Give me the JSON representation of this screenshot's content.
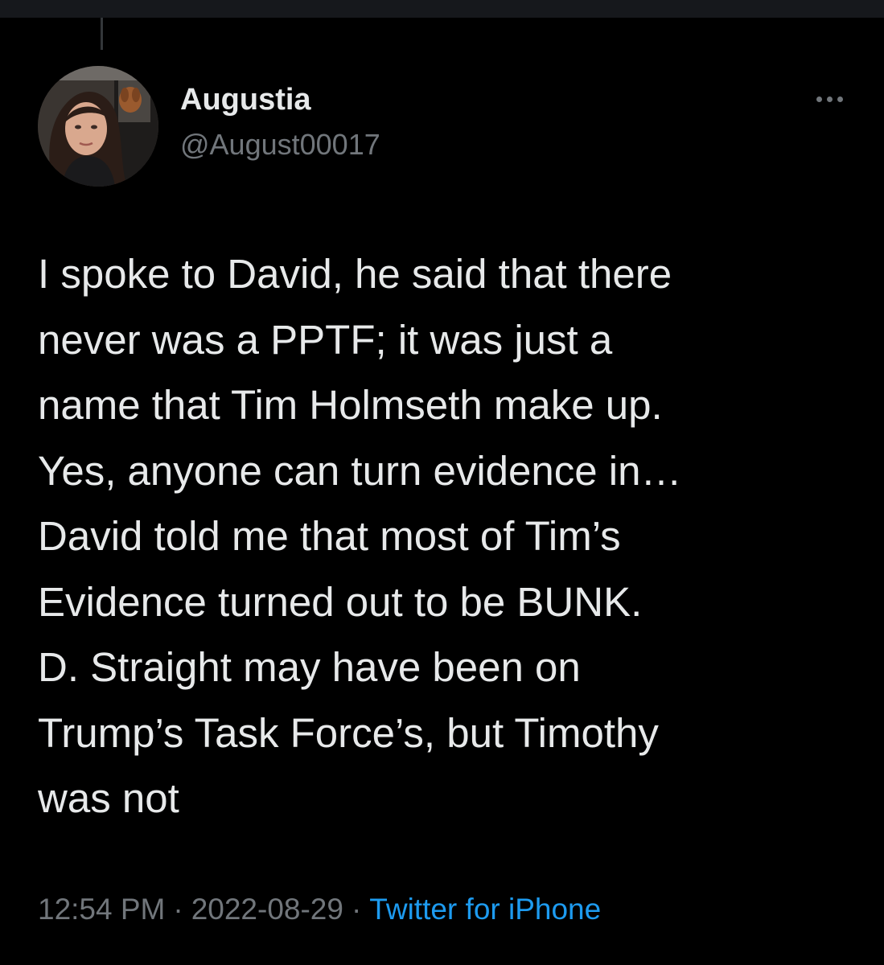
{
  "tweet": {
    "author": {
      "display_name": "Augustia",
      "handle": "@August00017"
    },
    "text_lines": [
      "I spoke to David, he said that there",
      "never was a PPTF; it was just a",
      "name that Tim Holmseth make up.",
      "Yes, anyone can turn evidence in…",
      "David told me that most of Tim’s",
      "Evidence turned out to be BUNK.",
      "D. Straight may have been on",
      "Trump’s Task Force’s, but Timothy",
      "was not"
    ],
    "time": "12:54 PM",
    "date": "2022-08-29",
    "separator": "·",
    "source": "Twitter for iPhone"
  },
  "icons": {
    "more": "more-horizontal-icon"
  },
  "colors": {
    "background": "#000000",
    "primary_text": "#e7e9ea",
    "secondary_text": "#71767b",
    "link": "#1d9bf0"
  }
}
